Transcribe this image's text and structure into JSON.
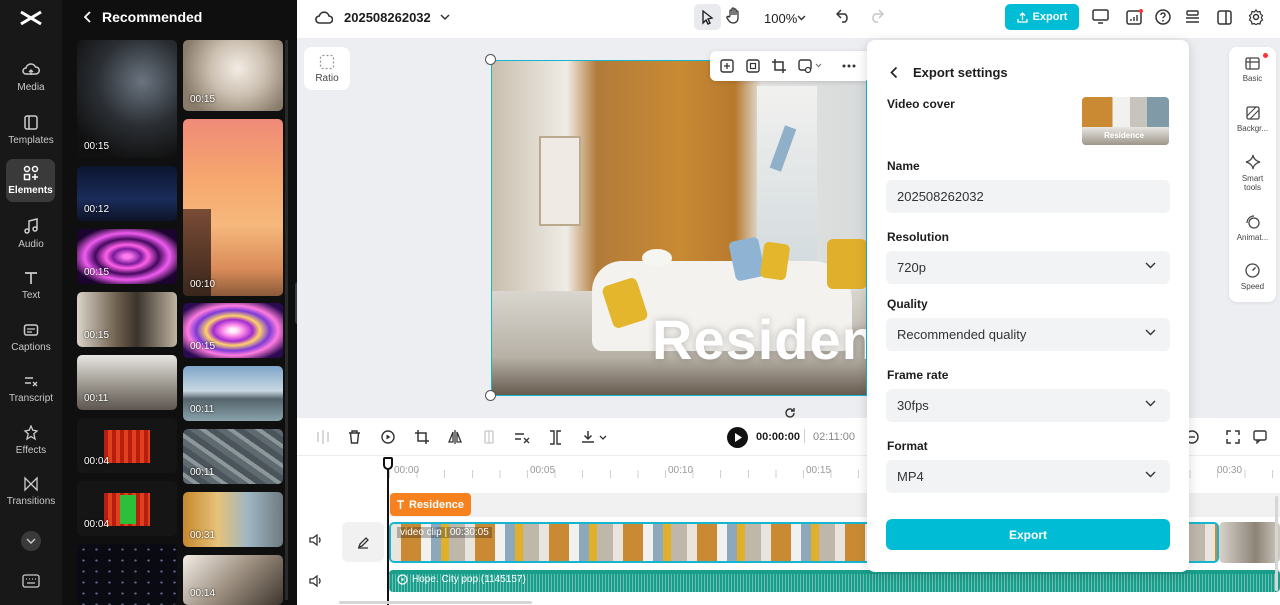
{
  "nav": {
    "items": [
      {
        "label": "Media",
        "icon": "cloud-upload-icon"
      },
      {
        "label": "Templates",
        "icon": "templates-icon"
      },
      {
        "label": "Elements",
        "icon": "elements-icon"
      },
      {
        "label": "Audio",
        "icon": "music-note-icon"
      },
      {
        "label": "Text",
        "icon": "text-icon"
      },
      {
        "label": "Captions",
        "icon": "captions-icon"
      },
      {
        "label": "Transcript",
        "icon": "transcript-icon"
      },
      {
        "label": "Effects",
        "icon": "effects-icon"
      },
      {
        "label": "Transitions",
        "icon": "transitions-icon"
      }
    ]
  },
  "panel": {
    "title": "Recommended",
    "col1": [
      {
        "dur": "00:15"
      },
      {
        "dur": "00:12"
      },
      {
        "dur": "00:15"
      },
      {
        "dur": "00:15"
      },
      {
        "dur": "00:11"
      },
      {
        "dur": "00:04"
      },
      {
        "dur": "00:04"
      }
    ],
    "col2": [
      {
        "dur": "00:15"
      },
      {
        "dur": "00:10"
      },
      {
        "dur": "00:15"
      },
      {
        "dur": "00:11"
      },
      {
        "dur": "00:11"
      },
      {
        "dur": "00:31"
      },
      {
        "dur": "00:14"
      }
    ]
  },
  "topbar": {
    "project_name": "202508262032",
    "zoom": "100%",
    "export_label": "Export"
  },
  "canvas": {
    "ratio_label": "Ratio",
    "overlay_text": "Residen"
  },
  "export": {
    "title": "Export settings",
    "cover_label": "Video cover",
    "cover_caption": "Residence",
    "name_label": "Name",
    "name_value": "202508262032",
    "resolution_label": "Resolution",
    "resolution_value": "720p",
    "quality_label": "Quality",
    "quality_value": "Recommended quality",
    "framerate_label": "Frame rate",
    "framerate_value": "30fps",
    "format_label": "Format",
    "format_value": "MP4",
    "export_button": "Export"
  },
  "rail": {
    "items": [
      {
        "label": "Basic"
      },
      {
        "label": "Backgr..."
      },
      {
        "label": "Smart tools"
      },
      {
        "label": "Animat..."
      },
      {
        "label": "Speed"
      }
    ]
  },
  "timeline": {
    "current_time": "00:00:00",
    "total_time": "02:11:00",
    "ticks": [
      "00:00",
      "00:05",
      "00:10",
      "00:15",
      "00:30"
    ],
    "text_clip": "Residence",
    "video_clip": "video clip",
    "video_duration": "00:30:05",
    "audio_clip": "Hope. City pop.(1145157)"
  },
  "colors": {
    "accent": "#00b7d6",
    "text_clip": "#f5821f",
    "audio_track": "#1a9e8c"
  }
}
